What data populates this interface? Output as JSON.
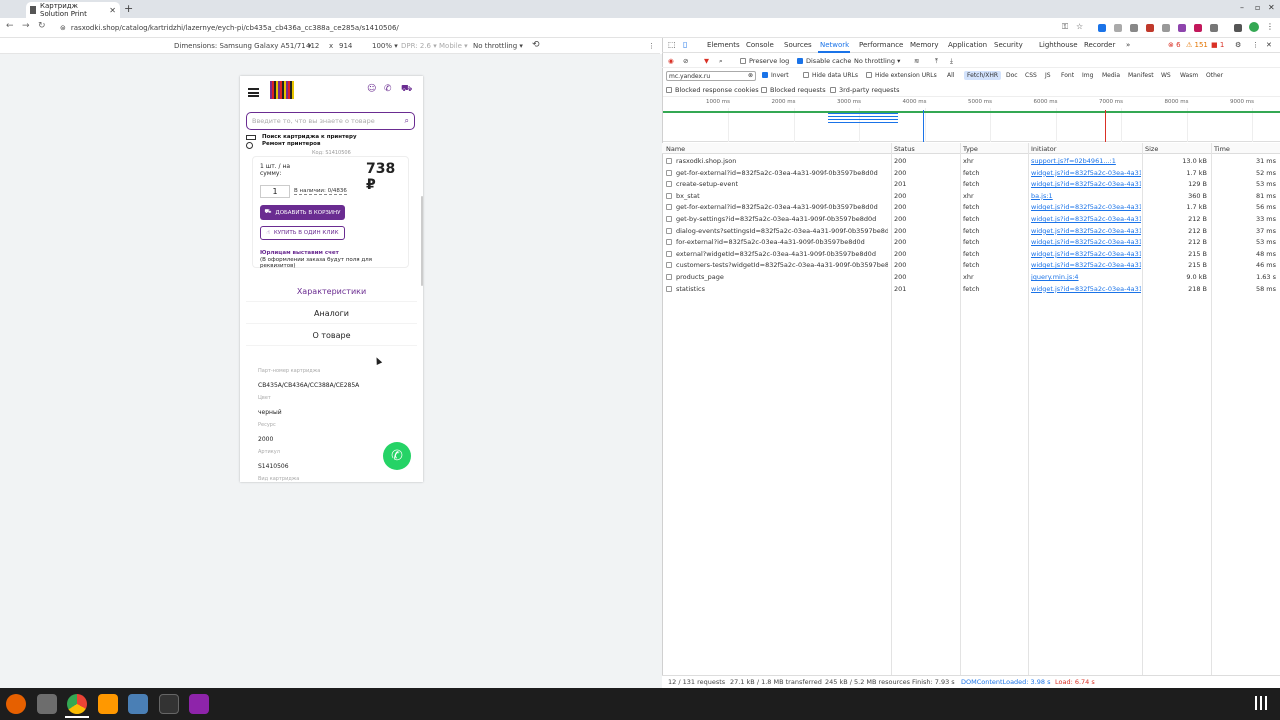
{
  "browser": {
    "tab_title": "Картридж Solution Print",
    "url": "rasxodki.shop/catalog/kartridzhi/lazernye/eych-pi/cb435a_cb436a_cc388a_ce285a/s1410506/"
  },
  "device_toolbar": {
    "dimensions": "Dimensions: Samsung Galaxy A51/71 ▾",
    "width": "412",
    "x": "x",
    "height": "914",
    "zoom": "100% ▾",
    "dpr": "DPR: 2.6 ▾",
    "mobile": "Mobile ▾",
    "throttle": "No throttling ▾"
  },
  "page": {
    "search_placeholder": "Введите то, что вы знаете о товаре",
    "promo_line1": "Поиск картриджа к принтеру",
    "promo_line2": "Ремонт принтеров",
    "article_hint": "Код: S1410506",
    "qty_label": "1 шт. / на сумму:",
    "price": "738 ₽",
    "qty": "1",
    "stock": "В наличии: 0/4836",
    "add_cart": "ДОБАВИТЬ В КОРЗИНУ",
    "one_click": "КУПИТЬ В ОДИН КЛИК",
    "yur_title": "Юрлицам выставим счет",
    "yur_note": "(В оформлении заказа будут поля для реквизитов)",
    "tab_specs": "Характеристики",
    "tab_analogs": "Аналоги",
    "tab_about": "О товаре",
    "specs": [
      {
        "k": "Парт-номер картриджа",
        "v": "CB435A/CB436A/CC388A/CE285A"
      },
      {
        "k": "Цвет",
        "v": "черный"
      },
      {
        "k": "Ресурс",
        "v": "2000"
      },
      {
        "k": "Артикул",
        "v": "S1410506"
      },
      {
        "k": "Вид картриджа",
        "v": ""
      }
    ]
  },
  "devtools": {
    "tabs": [
      "Elements",
      "Console",
      "Sources",
      "Network",
      "Performance",
      "Memory",
      "Application",
      "Security",
      "Lighthouse",
      "Recorder"
    ],
    "active_tab": "Network",
    "error_count": "6",
    "warn_count": "151",
    "info_count": "1",
    "preserve_log": "Preserve log",
    "disable_cache": "Disable cache",
    "no_throttling": "No throttling",
    "filter_value": "mc.yandex.ru",
    "invert": "Invert",
    "hide_data_urls": "Hide data URLs",
    "hide_ext_urls": "Hide extension URLs",
    "type_filters": [
      "All",
      "Fetch/XHR",
      "Doc",
      "CSS",
      "JS",
      "Font",
      "Img",
      "Media",
      "Manifest",
      "WS",
      "Wasm",
      "Other"
    ],
    "active_filter": "Fetch/XHR",
    "blocked_cookies": "Blocked response cookies",
    "blocked_requests": "Blocked requests",
    "third_party": "3rd-party requests",
    "timeline_ticks": [
      "1000 ms",
      "2000 ms",
      "3000 ms",
      "4000 ms",
      "5000 ms",
      "6000 ms",
      "7000 ms",
      "8000 ms",
      "9000 ms"
    ],
    "columns": [
      "Name",
      "Status",
      "Type",
      "Initiator",
      "Size",
      "Time"
    ],
    "rows": [
      {
        "name": "rasxodki.shop.json",
        "status": "200",
        "type": "xhr",
        "initiator": "support.js?f=02b4961...:1",
        "size": "13.0 kB",
        "time": "31 ms"
      },
      {
        "name": "get-for-external?id=832f5a2c-03ea-4a31-909f-0b3597be8d0d",
        "status": "200",
        "type": "fetch",
        "initiator": "widget.js?id=832f5a2c-03ea-4a31-909",
        "size": "1.7 kB",
        "time": "52 ms"
      },
      {
        "name": "create-setup-event",
        "status": "201",
        "type": "fetch",
        "initiator": "widget.js?id=832f5a2c-03ea-4a31-909",
        "size": "129 B",
        "time": "53 ms"
      },
      {
        "name": "bx_stat",
        "status": "200",
        "type": "xhr",
        "initiator": "ba.js:1",
        "size": "360 B",
        "time": "81 ms"
      },
      {
        "name": "get-for-external?id=832f5a2c-03ea-4a31-909f-0b3597be8d0d",
        "status": "200",
        "type": "fetch",
        "initiator": "widget.js?id=832f5a2c-03ea-4a31-909",
        "size": "1.7 kB",
        "time": "56 ms"
      },
      {
        "name": "get-by-settings?id=832f5a2c-03ea-4a31-909f-0b3597be8d0d",
        "status": "200",
        "type": "fetch",
        "initiator": "widget.js?id=832f5a2c-03ea-4a31-909",
        "size": "212 B",
        "time": "33 ms"
      },
      {
        "name": "dialog-events?settingsId=832f5a2c-03ea-4a31-909f-0b3597be8d0d",
        "status": "200",
        "type": "fetch",
        "initiator": "widget.js?id=832f5a2c-03ea-4a31-909",
        "size": "212 B",
        "time": "37 ms"
      },
      {
        "name": "for-external?id=832f5a2c-03ea-4a31-909f-0b3597be8d0d",
        "status": "200",
        "type": "fetch",
        "initiator": "widget.js?id=832f5a2c-03ea-4a31-909",
        "size": "212 B",
        "time": "53 ms"
      },
      {
        "name": "external?widgetId=832f5a2c-03ea-4a31-909f-0b3597be8d0d",
        "status": "200",
        "type": "fetch",
        "initiator": "widget.js?id=832f5a2c-03ea-4a31-909",
        "size": "215 B",
        "time": "48 ms"
      },
      {
        "name": "customers-tests?widgetId=832f5a2c-03ea-4a31-909f-0b3597be8d0d",
        "status": "200",
        "type": "fetch",
        "initiator": "widget.js?id=832f5a2c-03ea-4a31-909",
        "size": "215 B",
        "time": "46 ms"
      },
      {
        "name": "products_page",
        "status": "200",
        "type": "xhr",
        "initiator": "jquery.min.js:4",
        "size": "9.0 kB",
        "time": "1.63 s"
      },
      {
        "name": "statistics",
        "status": "201",
        "type": "fetch",
        "initiator": "widget.js?id=832f5a2c-03ea-4a31-909",
        "size": "218 B",
        "time": "58 ms"
      }
    ],
    "status_bar": {
      "requests": "12 / 131 requests",
      "transferred": "27.1 kB / 1.8 MB transferred",
      "resources": "245 kB / 5.2 MB resources",
      "finish": "Finish: 7.93 s",
      "dcl": "DOMContentLoaded: 3.98 s",
      "load": "Load: 6.74 s"
    }
  },
  "colors": {
    "accent": "#6a2c91",
    "devtools_blue": "#1a73e8",
    "dcl": "#1a73e8",
    "load": "#d93025"
  }
}
